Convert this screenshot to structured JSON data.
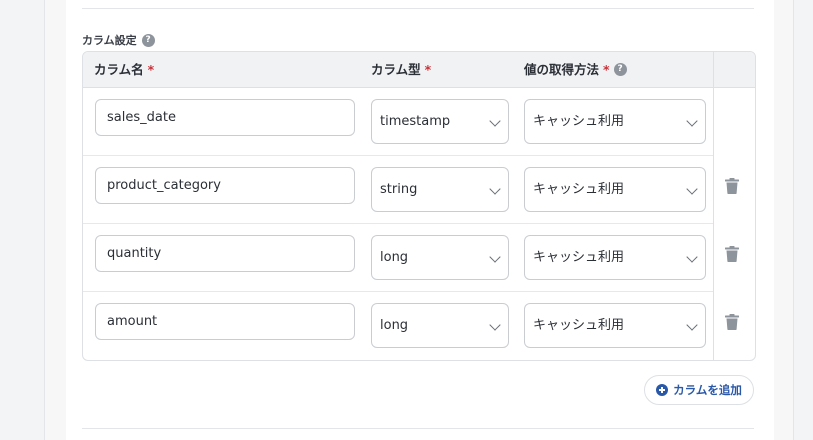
{
  "section": {
    "title": "カラム設定",
    "help_icon": "?"
  },
  "table": {
    "headers": {
      "name": "カラム名",
      "type": "カラム型",
      "method": "値の取得方法",
      "required_mark": "*"
    },
    "rows": [
      {
        "name": "sales_date",
        "type": "timestamp",
        "method": "キャッシュ利用",
        "deletable": false
      },
      {
        "name": "product_category",
        "type": "string",
        "method": "キャッシュ利用",
        "deletable": true
      },
      {
        "name": "quantity",
        "type": "long",
        "method": "キャッシュ利用",
        "deletable": true
      },
      {
        "name": "amount",
        "type": "long",
        "method": "キャッシュ利用",
        "deletable": true
      }
    ]
  },
  "add_button": {
    "label": "カラムを追加"
  },
  "colors": {
    "accent": "#2a58a8",
    "required": "#c8323a",
    "icon_gray": "#8e949c"
  }
}
